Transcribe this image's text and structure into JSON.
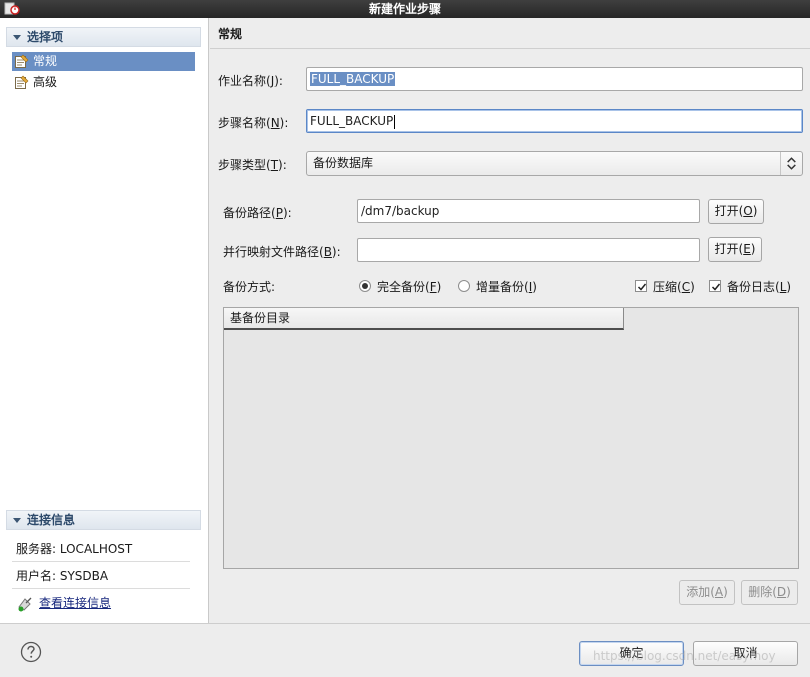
{
  "window": {
    "title": "新建作业步骤"
  },
  "left": {
    "select_header": "选择项",
    "nav": [
      {
        "label": "常规",
        "selected": true
      },
      {
        "label": "高级",
        "selected": false
      }
    ],
    "conn_header": "连接信息",
    "server": "服务器: LOCALHOST",
    "user": "用户名: SYSDBA",
    "view_conn_link": "查看连接信息"
  },
  "main": {
    "page_title": "常规",
    "job_name_label": "作业名称(J):",
    "job_name_value": "FULL_BACKUP",
    "step_name_label": "步骤名称(N):",
    "step_name_value": "FULL_BACKUP",
    "step_type_label": "步骤类型(T):",
    "step_type_value": "备份数据库",
    "backup_path_label": "备份路径(P):",
    "backup_path_value": "/dm7/backup",
    "open_btn_1": "打开(O)",
    "mapfile_label": "并行映射文件路径(B):",
    "mapfile_value": "",
    "open_btn_2": "打开(E)",
    "mode_label": "备份方式:",
    "radio_full": "完全备份(F)",
    "radio_incr": "增量备份(I)",
    "check_compress": "压缩(C)",
    "check_log": "备份日志(L)",
    "table_header": "基备份目录",
    "add_btn": "添加(A)",
    "del_btn": "删除(D)"
  },
  "footer": {
    "ok": "确定",
    "cancel": "取消",
    "watermark": "https://blog.csdn.net/easymoy"
  },
  "colors": {
    "selection": "#6a8fc4",
    "header_text": "#2d4a6b",
    "link": "#17277d"
  }
}
